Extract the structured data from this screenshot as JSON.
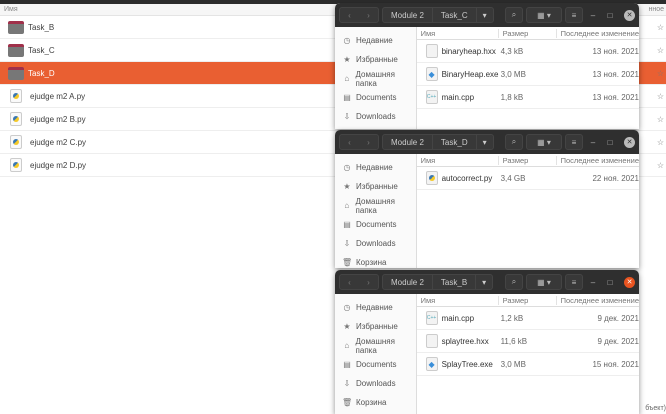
{
  "background": {
    "header": {
      "name_col": "Имя",
      "date_col_partial": "нное"
    },
    "rows": [
      {
        "name": "Task_B",
        "type": "folder"
      },
      {
        "name": "Task_C",
        "type": "folder"
      },
      {
        "name": "Task_D",
        "type": "folder",
        "selected": true
      },
      {
        "name": "ejudge m2 A.py",
        "type": "py"
      },
      {
        "name": "ejudge m2 B.py",
        "type": "py"
      },
      {
        "name": "ejudge m2 C.py",
        "type": "py"
      },
      {
        "name": "ejudge m2 D.py",
        "type": "py"
      }
    ],
    "status_partial": "бъект)"
  },
  "sidebar": [
    {
      "label": "Недавние",
      "icon": "clock-icon"
    },
    {
      "label": "Избранные",
      "icon": "star-icon"
    },
    {
      "label": "Домашняя папка",
      "icon": "home-icon"
    },
    {
      "label": "Documents",
      "icon": "document-icon"
    },
    {
      "label": "Downloads",
      "icon": "download-icon"
    },
    {
      "label": "Корзина",
      "icon": "trash-icon"
    }
  ],
  "columns": {
    "name": "Имя",
    "size": "Размер",
    "modified": "Последнее изменение"
  },
  "windows": [
    {
      "path": [
        "Module 2",
        "Task_C"
      ],
      "active": false,
      "files": [
        {
          "name": "binaryheap.hxx",
          "size": "4,3 kB",
          "date": "13 ноя. 2021",
          "icon": "text"
        },
        {
          "name": "BinaryHeap.exe",
          "size": "3,0 MB",
          "date": "13 ноя. 2021",
          "icon": "exe"
        },
        {
          "name": "main.cpp",
          "size": "1,8 kB",
          "date": "13 ноя. 2021",
          "icon": "cpp"
        }
      ]
    },
    {
      "path": [
        "Module 2",
        "Task_D"
      ],
      "active": false,
      "files": [
        {
          "name": "autocorrect.py",
          "size": "3,4 GB",
          "date": "22 ноя. 2021",
          "icon": "py"
        }
      ]
    },
    {
      "path": [
        "Module 2",
        "Task_B"
      ],
      "active": true,
      "files": [
        {
          "name": "main.cpp",
          "size": "1,2 kB",
          "date": "9 дек. 2021",
          "icon": "cpp"
        },
        {
          "name": "splaytree.hxx",
          "size": "11,6 kB",
          "date": "9 дек. 2021",
          "icon": "text"
        },
        {
          "name": "SplayTree.exe",
          "size": "3,0 MB",
          "date": "15 ноя. 2021",
          "icon": "exe"
        }
      ]
    }
  ],
  "colors": {
    "accent": "#e95f32",
    "headerbar": "#2f2f2f"
  }
}
